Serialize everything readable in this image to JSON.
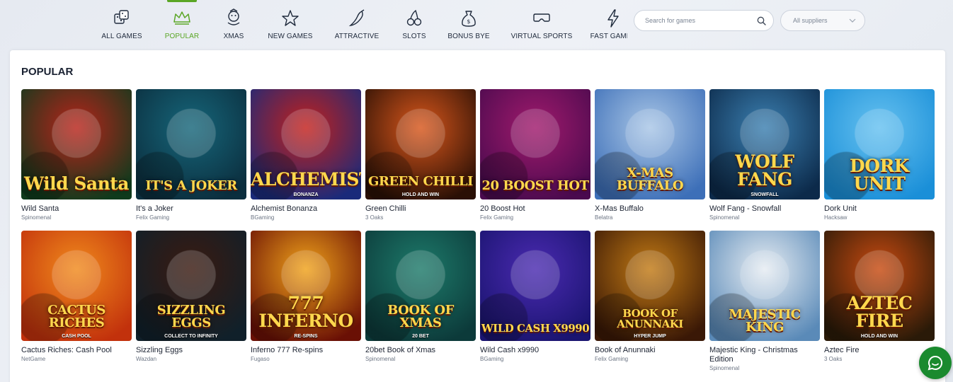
{
  "nav": {
    "categories": [
      {
        "label": "ALL GAMES",
        "icon": "dice-icon"
      },
      {
        "label": "POPULAR",
        "icon": "crown-icon"
      },
      {
        "label": "XMAS",
        "icon": "snowman-icon"
      },
      {
        "label": "NEW GAMES",
        "icon": "star-icon"
      },
      {
        "label": "ATTRACTIVE",
        "icon": "chili-icon"
      },
      {
        "label": "SLOTS",
        "icon": "cherries-icon"
      },
      {
        "label": "BONUS BYE",
        "icon": "money-bag-icon"
      },
      {
        "label": "VIRTUAL SPORTS",
        "icon": "vr-headset-icon"
      },
      {
        "label": "FAST GAMES",
        "icon": "lightning-icon"
      }
    ],
    "active": "POPULAR",
    "accent": "#5aa625"
  },
  "search": {
    "placeholder": "Search for games"
  },
  "supplier_filter": {
    "value": "All suppliers"
  },
  "section": {
    "title": "POPULAR"
  },
  "games": [
    {
      "name": "Wild Santa",
      "provider": "Spinomenal",
      "logo": "Wild Santa",
      "sub": "",
      "bg": [
        "#0f3a1c",
        "#b8231a"
      ]
    },
    {
      "name": "It's a Joker",
      "provider": "Felix Gaming",
      "logo": "IT'S A JOKER",
      "sub": "",
      "bg": [
        "#0b2e3e",
        "#16667a"
      ]
    },
    {
      "name": "Alchemist Bonanza",
      "provider": "BGaming",
      "logo": "ALCHEMIST",
      "sub": "BONANZA",
      "bg": [
        "#1a2a7a",
        "#c3201b"
      ]
    },
    {
      "name": "Green Chilli",
      "provider": "3 Oaks",
      "logo": "GREEN CHILLI",
      "sub": "HOLD AND WIN",
      "bg": [
        "#2a1005",
        "#d8561b"
      ]
    },
    {
      "name": "20 Boost Hot",
      "provider": "Felix Gaming",
      "logo": "20 BOOST HOT",
      "sub": "",
      "bg": [
        "#4a0a4e",
        "#a01a6c"
      ]
    },
    {
      "name": "X-Mas Buffalo",
      "provider": "Belatra",
      "logo": "X-MAS BUFFALO",
      "sub": "",
      "bg": [
        "#3d6fb8",
        "#a9c6e6"
      ]
    },
    {
      "name": "Wolf Fang - Snowfall",
      "provider": "Spinomenal",
      "logo": "WOLF FANG",
      "sub": "SNOWFALL",
      "bg": [
        "#0c2a4a",
        "#3b7fb0"
      ]
    },
    {
      "name": "Dork Unit",
      "provider": "Hacksaw",
      "logo": "DORK UNIT",
      "sub": "",
      "bg": [
        "#1a8fd8",
        "#66c1f0"
      ]
    },
    {
      "name": "Cactus Riches: Cash Pool",
      "provider": "NetGame",
      "logo": "CACTUS RICHES",
      "sub": "CASH POOL",
      "bg": [
        "#c2310c",
        "#f08a1c"
      ]
    },
    {
      "name": "Sizzling Eggs",
      "provider": "Wazdan",
      "logo": "SIZZLING EGGS",
      "sub": "COLLECT TO INFINITY",
      "bg": [
        "#10202a",
        "#3a1a10"
      ]
    },
    {
      "name": "Inferno 777 Re-spins",
      "provider": "Fugaso",
      "logo": "777 INFERNO",
      "sub": "RE-SPINS",
      "bg": [
        "#6a1005",
        "#f0a21a"
      ]
    },
    {
      "name": "20bet Book of Xmas",
      "provider": "Spinomenal",
      "logo": "BOOK OF XMAS",
      "sub": "20 BET",
      "bg": [
        "#0c3a3a",
        "#1d7a6a"
      ]
    },
    {
      "name": "Wild Cash x9990",
      "provider": "BGaming",
      "logo": "WILD CASH X9990",
      "sub": "",
      "bg": [
        "#1a1470",
        "#4a2ab0"
      ]
    },
    {
      "name": "Book of Anunnaki",
      "provider": "Felix Gaming",
      "logo": "BOOK OF ANUNNAKI",
      "sub": "HYPER JUMP",
      "bg": [
        "#3a1806",
        "#c27a14"
      ]
    },
    {
      "name": "Majestic King - Christmas Edition",
      "provider": "Spinomenal",
      "logo": "MAJESTIC KING",
      "sub": "",
      "bg": [
        "#5a8ab8",
        "#e6ecf2"
      ]
    },
    {
      "name": "Aztec Fire",
      "provider": "3 Oaks",
      "logo": "AZTEC FIRE",
      "sub": "HOLD AND WIN",
      "bg": [
        "#2a1a08",
        "#c84a10"
      ]
    }
  ]
}
